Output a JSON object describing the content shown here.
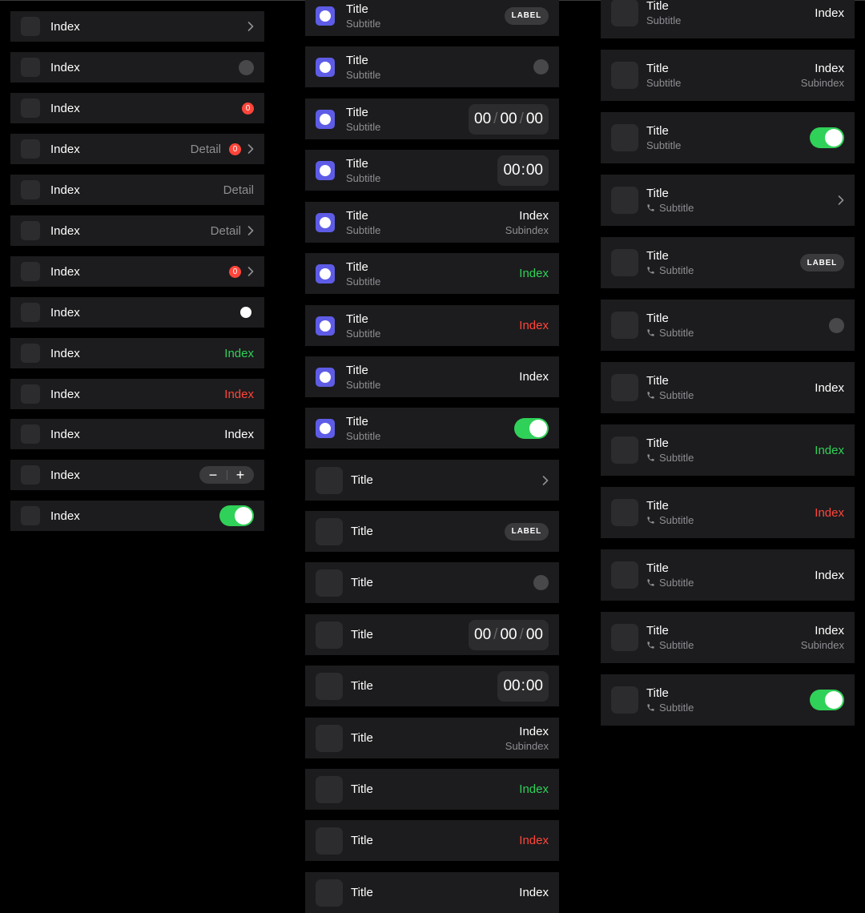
{
  "labels": {
    "index": "Index",
    "title": "Title",
    "subtitle": "Subtitle",
    "detail": "Detail",
    "subindex": "Subindex",
    "pill": "LABEL",
    "badge_count": "0",
    "minus": "−",
    "plus": "+"
  },
  "time": {
    "hh": "00",
    "mm": "00",
    "ss": "00",
    "sep": "/",
    "colon": ":"
  },
  "colors": {
    "background": "#000000",
    "row_bg": "#1c1c1e",
    "accent_icon": "#5e5ce6",
    "green": "#30d158",
    "red": "#ff453a",
    "muted": "#8e8e93"
  },
  "icons": [
    "chevron-right-icon",
    "phone-icon",
    "app-icon",
    "toggle",
    "stepper"
  ]
}
